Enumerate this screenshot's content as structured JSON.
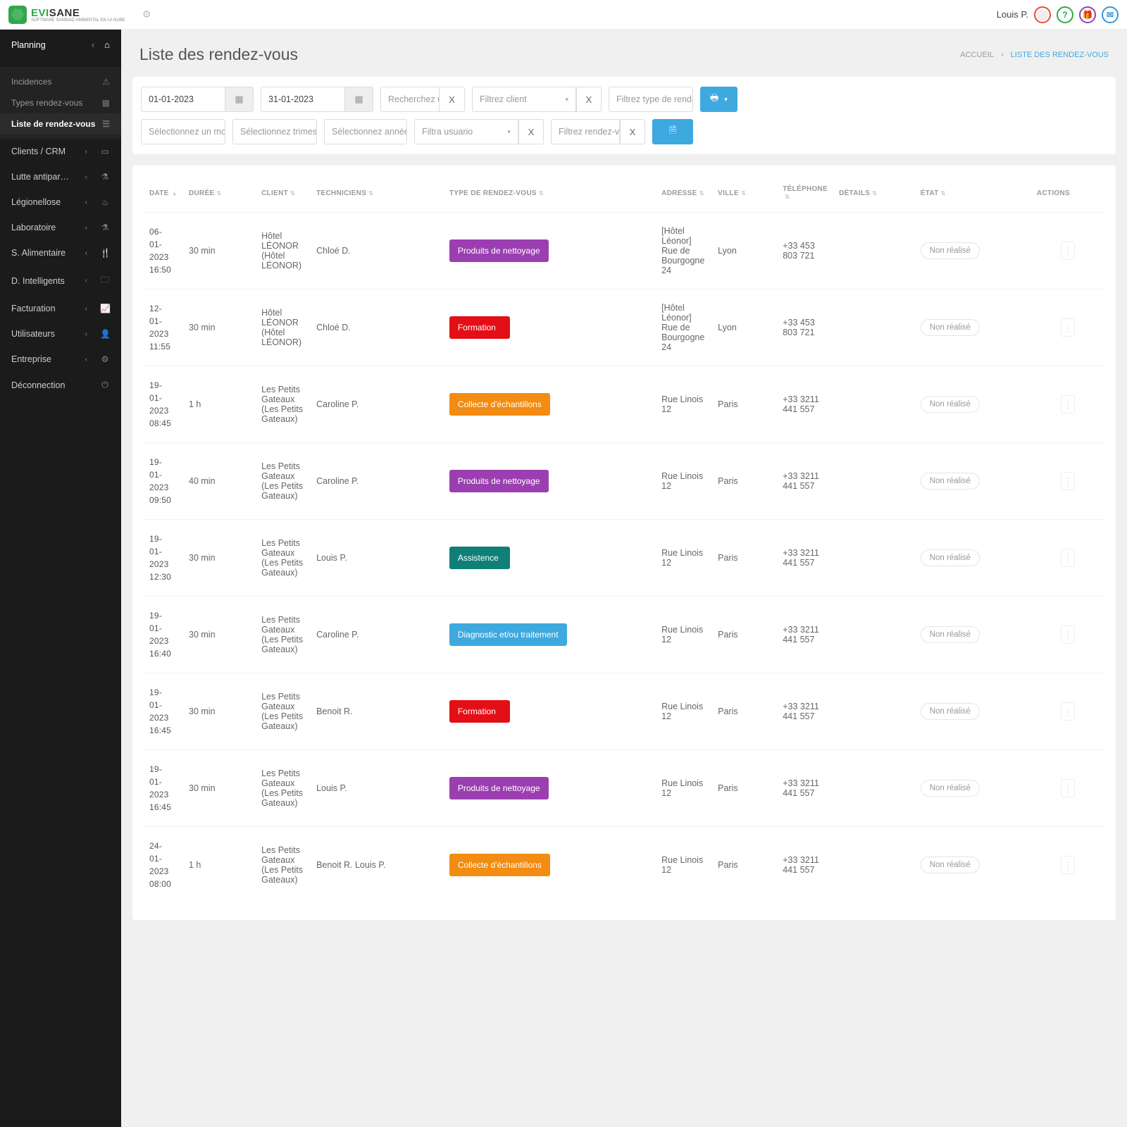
{
  "topbar": {
    "logo_main": "EVI",
    "logo_sub": "SANE",
    "logo_tagline": "SOFTWARE SANIDAD AMBIENTAL EN LA NUBE",
    "user": "Louis P."
  },
  "sidebar": {
    "section": "Planning",
    "subitems": [
      {
        "label": "Incidences"
      },
      {
        "label": "Types rendez-vous"
      },
      {
        "label": "Liste de rendez-vous",
        "active": true
      }
    ],
    "items": [
      {
        "label": "Clients / CRM",
        "icon": "▭"
      },
      {
        "label": "Lutte antipar…",
        "icon": "⚗"
      },
      {
        "label": "Légionellose",
        "icon": "♨"
      },
      {
        "label": "Laboratoire",
        "icon": "⚗"
      },
      {
        "label": "S. Alimentaire",
        "icon": "🍴"
      },
      {
        "label": "D. Intelligents",
        "icon": "🗀"
      },
      {
        "label": "Facturation",
        "icon": "📈"
      },
      {
        "label": "Utilisateurs",
        "icon": "👤"
      },
      {
        "label": "Entreprise",
        "icon": "⚙"
      },
      {
        "label": "Déconnection",
        "icon": "⏻",
        "nochev": true
      }
    ]
  },
  "header": {
    "title": "Liste des rendez-vous",
    "crumb_home": "ACCUEIL",
    "crumb_current": "LISTE DES RENDEZ-VOUS"
  },
  "filters": {
    "date_from": "01-01-2023",
    "date_to": "31-01-2023",
    "search_placeholder": "Recherchez un client",
    "filter_client": "Filtrez client",
    "filter_type": "Filtrez type de rendez-vous",
    "sel_month": "Sélectionnez un mois",
    "sel_quarter": "Sélectionnez trimestre",
    "sel_year": "Sélectionnez année",
    "filter_user": "Filtra usuario",
    "filter_rdv": "Filtrez rendez-vous"
  },
  "table": {
    "headers": {
      "date": "DATE",
      "duree": "DURÉE",
      "client": "CLIENT",
      "tech": "TECHNICIENS",
      "type": "TYPE DE RENDEZ-VOUS",
      "adresse": "ADRESSE",
      "ville": "VILLE",
      "tel": "TÉLÉPHONE",
      "details": "DÉTAILS",
      "etat": "ÉTAT",
      "actions": "ACTIONS"
    },
    "status_label": "Non réalisé",
    "rows": [
      {
        "date": "06-01-2023 16:50",
        "duree": "30 min",
        "client": "Hôtel LÉONOR (Hôtel LÉONOR)",
        "tech": "Chloé D.",
        "type": "Produits de nettoyage",
        "color": "#9b3fb0",
        "adresse": "[Hôtel Léonor] Rue de Bourgogne 24",
        "ville": "Lyon",
        "tel": "+33 453 803 721"
      },
      {
        "date": "12-01-2023 11:55",
        "duree": "30 min",
        "client": "Hôtel LÉONOR (Hôtel LÉONOR)",
        "tech": "Chloé D.",
        "type": "Formation",
        "color": "#e40f16",
        "adresse": "[Hôtel Léonor] Rue de Bourgogne 24",
        "ville": "Lyon",
        "tel": "+33 453 803 721"
      },
      {
        "date": "19-01-2023 08:45",
        "duree": "1 h",
        "client": "Les Petits Gateaux (Les Petits Gateaux)",
        "tech": "Caroline P.",
        "type": "Collecte d'échantillons",
        "color": "#f28c12",
        "adresse": "Rue Linois 12",
        "ville": "Paris",
        "tel": "+33 3211 441 557"
      },
      {
        "date": "19-01-2023 09:50",
        "duree": "40 min",
        "client": "Les Petits Gateaux (Les Petits Gateaux)",
        "tech": "Caroline P.",
        "type": "Produits de nettoyage",
        "color": "#9b3fb0",
        "adresse": "Rue Linois 12",
        "ville": "Paris",
        "tel": "+33 3211 441 557"
      },
      {
        "date": "19-01-2023 12:30",
        "duree": "30 min",
        "client": "Les Petits Gateaux (Les Petits Gateaux)",
        "tech": "Louis P.",
        "type": "Assistence",
        "color": "#0e8077",
        "adresse": "Rue Linois 12",
        "ville": "Paris",
        "tel": "+33 3211 441 557"
      },
      {
        "date": "19-01-2023 16:40",
        "duree": "30 min",
        "client": "Les Petits Gateaux (Les Petits Gateaux)",
        "tech": "Caroline P.",
        "type": "Diagnostic et/ou traitement",
        "color": "#3ea9de",
        "adresse": "Rue Linois 12",
        "ville": "Paris",
        "tel": "+33 3211 441 557"
      },
      {
        "date": "19-01-2023 16:45",
        "duree": "30 min",
        "client": "Les Petits Gateaux (Les Petits Gateaux)",
        "tech": "Benoit R.",
        "type": "Formation",
        "color": "#e40f16",
        "adresse": "Rue Linois 12",
        "ville": "Paris",
        "tel": "+33 3211 441 557"
      },
      {
        "date": "19-01-2023 16:45",
        "duree": "30 min",
        "client": "Les Petits Gateaux (Les Petits Gateaux)",
        "tech": "Louis P.",
        "type": "Produits de nettoyage",
        "color": "#9b3fb0",
        "adresse": "Rue Linois 12",
        "ville": "Paris",
        "tel": "+33 3211 441 557"
      },
      {
        "date": "24-01-2023 08:00",
        "duree": "1 h",
        "client": "Les Petits Gateaux (Les Petits Gateaux)",
        "tech": "Benoit R. Louis P.",
        "type": "Collecte d'échantillons",
        "color": "#f28c12",
        "adresse": "Rue Linois 12",
        "ville": "Paris",
        "tel": "+33 3211 441 557"
      }
    ]
  }
}
